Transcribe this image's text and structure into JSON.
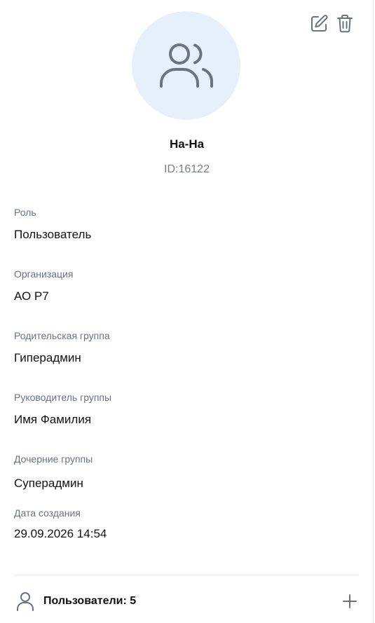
{
  "header": {
    "icons": [
      "edit-icon",
      "trash-icon"
    ]
  },
  "group": {
    "avatar_icon": "users-group-icon",
    "name": "На-На",
    "id_text": "ID:16122"
  },
  "fields": {
    "role": {
      "label": "Роль",
      "value": "Пользователь"
    },
    "organization": {
      "label": "Организация",
      "value": "АО Р7"
    },
    "parent_group": {
      "label": "Родительская группа",
      "value": "Гиперадмин"
    },
    "group_leader": {
      "label": "Руководитель группы",
      "value": "Имя Фамилия"
    },
    "child_groups": {
      "label": "Дочерние группы",
      "value": "Суперадмин"
    },
    "created": {
      "label": "Дата создания",
      "value": "29.09.2026 14:54"
    }
  },
  "users_section": {
    "icon": "user-icon",
    "label": "Пользователи: 5",
    "add_icon": "plus-icon"
  },
  "colors": {
    "avatar_bg": "#e6f0fb",
    "icon_gray": "#6b7280",
    "label_gray": "#6c7280",
    "text": "#111111"
  }
}
